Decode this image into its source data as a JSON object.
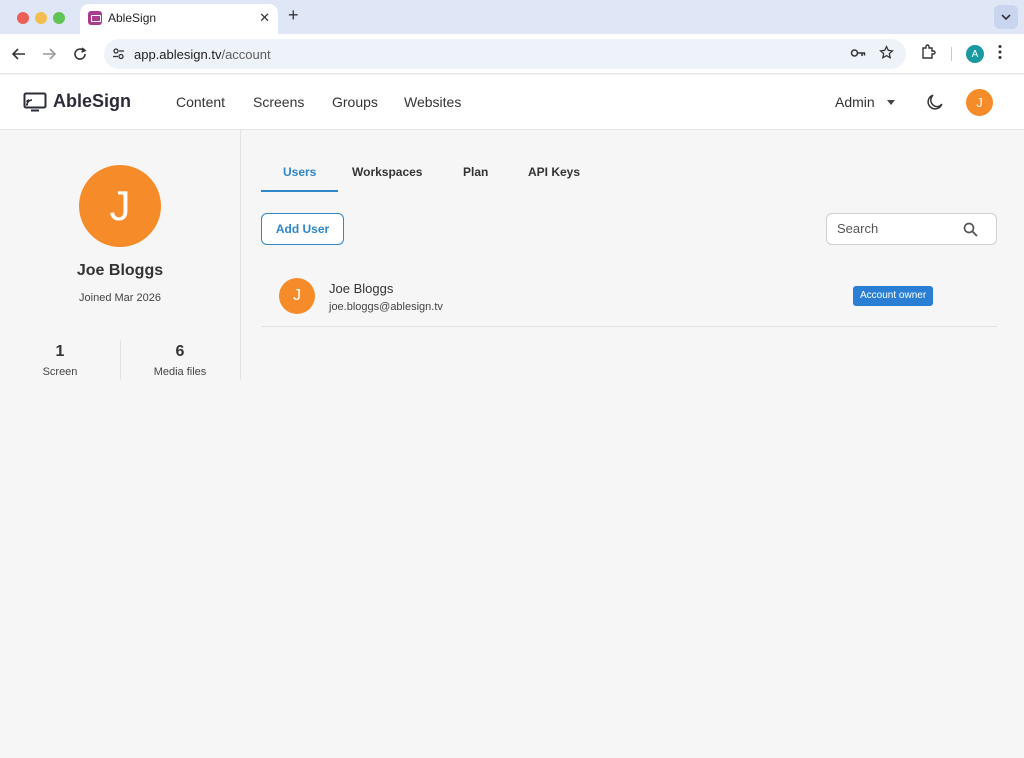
{
  "browser": {
    "tab_title": "AbleSign",
    "tab_close_glyph": "✕",
    "new_tab_glyph": "+",
    "url_host": "app.ablesign.tv",
    "url_path": "/account",
    "profile_initial": "A",
    "icons": [
      "back-icon",
      "forward-icon",
      "reload-icon",
      "site-settings-icon",
      "password-key-icon",
      "bookmark-star-icon",
      "extensions-icon",
      "menu-kebab-icon",
      "tab-search-chevron-icon"
    ]
  },
  "header": {
    "logo_text": "AbleSign",
    "nav": [
      "Content",
      "Screens",
      "Groups",
      "Websites"
    ],
    "admin_label": "Admin",
    "user_initial": "J"
  },
  "profile": {
    "initial": "J",
    "name": "Joe Bloggs",
    "joined": "Joined Mar 2026",
    "stats": [
      {
        "value": "1",
        "label": "Screen"
      },
      {
        "value": "6",
        "label": "Media files"
      }
    ]
  },
  "tabs": {
    "items": [
      "Users",
      "Workspaces",
      "Plan",
      "API Keys"
    ],
    "active": "Users"
  },
  "actions": {
    "add_user_label": "Add User",
    "search_placeholder": "Search"
  },
  "users": [
    {
      "initial": "J",
      "name": "Joe Bloggs",
      "email": "joe.bloggs@ablesign.tv",
      "badge": "Account owner"
    }
  ],
  "colors": {
    "accent": "#2f86c9",
    "avatar": "#f68b2a",
    "badge": "#2a7fd4",
    "favicon": "#a83d8f"
  }
}
